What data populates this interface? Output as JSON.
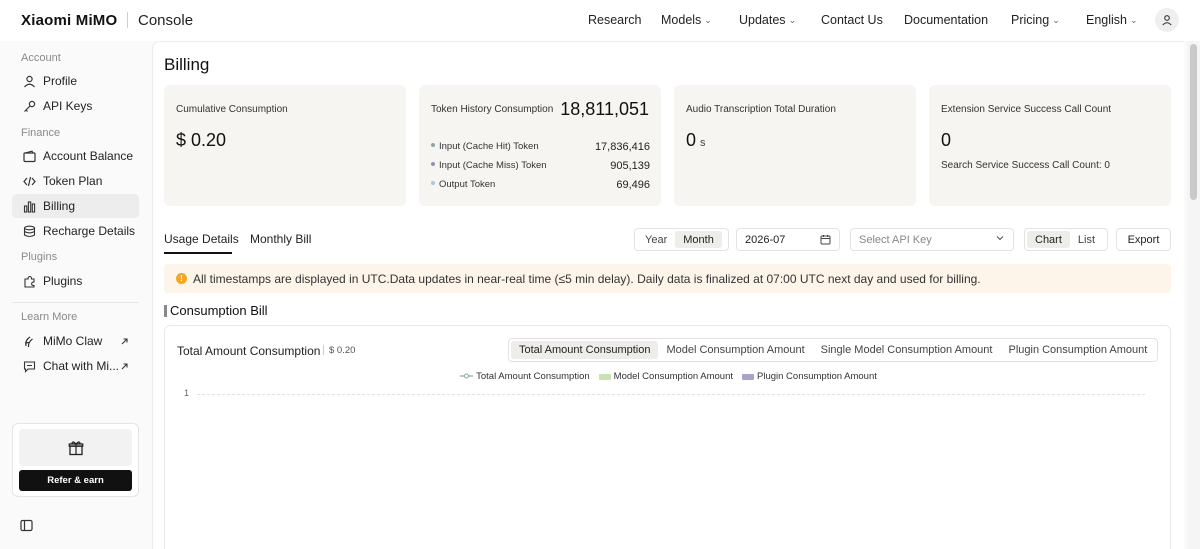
{
  "topnav": {
    "brand": "Xiaomi MiMO",
    "console": "Console",
    "items": [
      {
        "label": "Research",
        "dropdown": false
      },
      {
        "label": "Models",
        "dropdown": true
      },
      {
        "label": "Updates",
        "dropdown": true
      },
      {
        "label": "Contact Us",
        "dropdown": false
      },
      {
        "label": "Documentation",
        "dropdown": false
      },
      {
        "label": "Pricing",
        "dropdown": true
      },
      {
        "label": "English",
        "dropdown": true
      }
    ],
    "user_icon": "user-icon"
  },
  "sidebar": {
    "sections": [
      "Account",
      "Finance",
      "Plugins",
      "Learn More"
    ],
    "items": [
      {
        "label": "Profile",
        "icon": "user-icon"
      },
      {
        "label": "API Keys",
        "icon": "key-icon"
      },
      {
        "label": "Account Balance",
        "icon": "wallet-icon"
      },
      {
        "label": "Token Plan",
        "icon": "code-icon"
      },
      {
        "label": "Billing",
        "icon": "bar-chart-icon",
        "active": true
      },
      {
        "label": "Recharge Details",
        "icon": "database-icon"
      },
      {
        "label": "Plugins",
        "icon": "puzzle-icon"
      },
      {
        "label": "MiMo Claw",
        "icon": "claw-icon",
        "external": true
      },
      {
        "label": "Chat with Mi...",
        "icon": "chat-icon",
        "external": true
      }
    ],
    "refer_label": "Refer & earn"
  },
  "page": {
    "title": "Billing"
  },
  "cards": {
    "cumulative": {
      "label": "Cumulative Consumption",
      "value": "$ 0.20"
    },
    "tokens": {
      "label": "Token History Consumption",
      "value": "18,811,051",
      "rows": [
        {
          "label": "Input (Cache Hit) Token",
          "value": "17,836,416",
          "color": "#8fa3a8"
        },
        {
          "label": "Input (Cache Miss) Token",
          "value": "905,139",
          "color": "#9a8fb8"
        },
        {
          "label": "Output Token",
          "value": "69,496",
          "color": "#a9c7e0"
        }
      ]
    },
    "audio": {
      "label": "Audio Transcription Total Duration",
      "value": "0",
      "unit": "s"
    },
    "extension": {
      "label": "Extension Service Success Call Count",
      "value": "0",
      "sub": "Search Service Success Call Count: 0"
    }
  },
  "tabs": {
    "usage": "Usage Details",
    "monthly": "Monthly Bill"
  },
  "controls": {
    "period_options": [
      "Year",
      "Month"
    ],
    "period_selected": "Month",
    "date_value": "2026-07",
    "api_key_placeholder": "Select API Key",
    "view_options": [
      "Chart",
      "List"
    ],
    "view_selected": "Chart",
    "export_label": "Export"
  },
  "notice": "All timestamps are displayed in UTC.Data updates in near-real time (≤5 min delay). Daily data is finalized at 07:00 UTC next day and used for billing.",
  "section_title": "Consumption Bill",
  "chart_data": {
    "type": "line",
    "title": "Total Amount Consumption",
    "total": "$ 0.20",
    "tabs": [
      "Total Amount Consumption",
      "Model Consumption Amount",
      "Single Model Consumption Amount",
      "Plugin Consumption Amount"
    ],
    "active_tab": "Total Amount Consumption",
    "series": [
      {
        "name": "Total Amount Consumption",
        "values": [],
        "color": "#8fa3a8"
      },
      {
        "name": "Model Consumption Amount",
        "values": [],
        "color": "#c7e3b4"
      },
      {
        "name": "Plugin Consumption Amount",
        "values": [],
        "color": "#a9a1cf"
      }
    ],
    "y_ticks": [
      "1"
    ],
    "legend_position": "top-center",
    "grid": true
  }
}
